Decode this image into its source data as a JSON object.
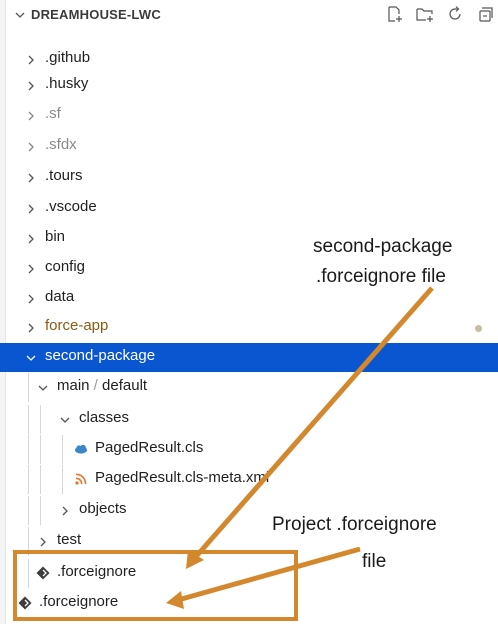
{
  "explorer": {
    "title": "DREAMHOUSE-LWC",
    "actions": [
      "new-file-icon",
      "new-folder-icon",
      "refresh-icon",
      "collapse-all-icon"
    ],
    "items": [
      {
        "label": ".github",
        "type": "folder",
        "state": "collapsed",
        "depth": 0
      },
      {
        "label": ".husky",
        "type": "folder",
        "state": "collapsed",
        "depth": 0
      },
      {
        "label": ".sf",
        "type": "folder",
        "state": "collapsed",
        "depth": 0,
        "muted": true
      },
      {
        "label": ".sfdx",
        "type": "folder",
        "state": "collapsed",
        "depth": 0,
        "muted": true
      },
      {
        "label": ".tours",
        "type": "folder",
        "state": "collapsed",
        "depth": 0
      },
      {
        "label": ".vscode",
        "type": "folder",
        "state": "collapsed",
        "depth": 0
      },
      {
        "label": "bin",
        "type": "folder",
        "state": "collapsed",
        "depth": 0
      },
      {
        "label": "config",
        "type": "folder",
        "state": "collapsed",
        "depth": 0
      },
      {
        "label": "data",
        "type": "folder",
        "state": "collapsed",
        "depth": 0
      },
      {
        "label": "force-app",
        "type": "folder",
        "state": "collapsed",
        "depth": 0,
        "modified": true
      },
      {
        "label": "second-package",
        "type": "folder",
        "state": "expanded",
        "depth": 0,
        "selected": true
      },
      {
        "label_a": "main",
        "label_b": "default",
        "type": "folder",
        "state": "expanded",
        "depth": 1
      },
      {
        "label": "classes",
        "type": "folder",
        "state": "expanded",
        "depth": 2
      },
      {
        "label": "PagedResult.cls",
        "type": "file",
        "icon": "salesforce-cloud-icon",
        "depth": 3
      },
      {
        "label": "PagedResult.cls-meta.xml",
        "type": "file",
        "icon": "rss-xml-icon",
        "depth": 3
      },
      {
        "label": "objects",
        "type": "folder",
        "state": "collapsed",
        "depth": 2
      },
      {
        "label": "test",
        "type": "folder",
        "state": "collapsed",
        "depth": 1
      },
      {
        "label": ".forceignore",
        "type": "file",
        "icon": "forceignore-diamond-icon",
        "depth": 1
      },
      {
        "label": ".forceignore",
        "type": "file",
        "icon": "forceignore-diamond-icon",
        "depth": 0
      }
    ]
  },
  "annotations": {
    "callout_top_line1": "second-package",
    "callout_top_line2": ".forceignore file",
    "callout_bottom_line1": "Project .forceignore",
    "callout_bottom_line2": "file",
    "accent_color": "#d4882e"
  },
  "colors": {
    "selection": "#0a55d0",
    "modified_text": "#8a5b12",
    "muted_text": "#8a8a8a"
  }
}
